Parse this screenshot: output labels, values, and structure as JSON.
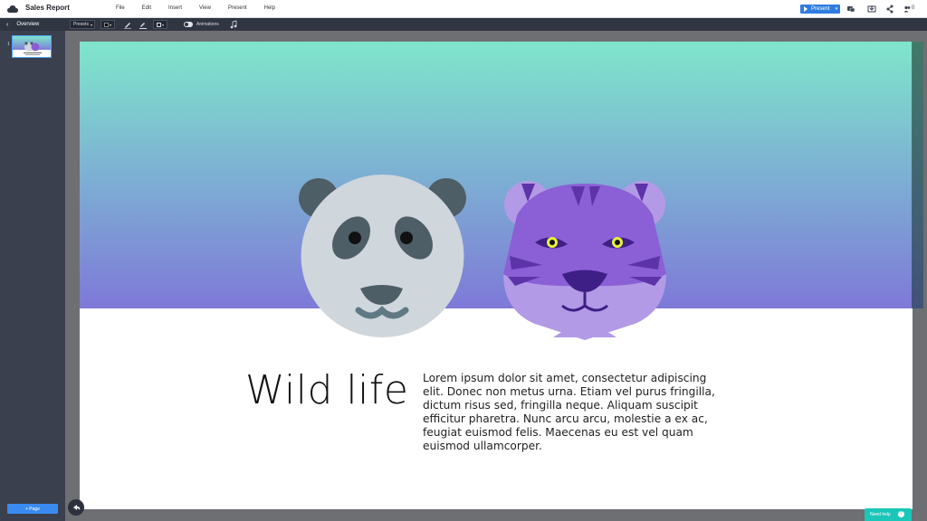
{
  "app": {
    "doc_title": "Sales Report"
  },
  "menu": [
    "File",
    "Edit",
    "Insert",
    "View",
    "Present",
    "Help"
  ],
  "header": {
    "present_label": "Present",
    "collaborators_count": "0"
  },
  "toolbar": {
    "overview_label": "Overview",
    "presets_label": "Presets",
    "animations_label": "Animations"
  },
  "sidebar": {
    "slide_number": "1",
    "add_page_label": "+ Page"
  },
  "slide": {
    "title": "Wild life",
    "body": "Lorem ipsum dolor sit amet, consectetur adipiscing elit. Donec non metus urna. Etiam vel purus fringilla, dictum risus sed, fringilla neque. Aliquam suscipit efficitur pharetra. Nunc arcu arcu, molestie a ex ac, feugiat euismod felis. Maecenas eu est vel quam euismod ullamcorper."
  },
  "help": {
    "label": "Need help"
  },
  "colors": {
    "accent": "#2f7de1",
    "gradient_top": "#7fe6cb",
    "gradient_bottom": "#7e79d8",
    "help": "#19c6b8"
  }
}
